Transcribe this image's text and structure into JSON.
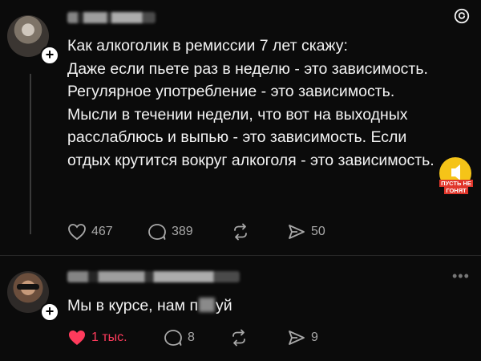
{
  "post": {
    "text": "Как алкоголик в ремиссии 7 лет скажу:\nДаже если пьете раз в неделю - это зависимость. Регулярное употребление - это зависимость. Мысли в течении недели, что вот на выходных расслаблюсь и выпью - это зависимость. Если отдых крутится вокруг алкоголя - это зависимость.",
    "likes": "467",
    "replies": "389",
    "shares": "50"
  },
  "reply": {
    "text_before": "Мы в курсе, нам п",
    "text_after": "уй",
    "likes": "1 тыс.",
    "replies": "8",
    "shares": "9"
  },
  "badge": {
    "line1": "Пусть не",
    "line2": "гонят"
  },
  "colors": {
    "background": "#0b0b0b",
    "text": "#f3f3f3",
    "muted": "#a8a8a8",
    "liked": "#ff3b5c",
    "badge_yellow": "#f5c418",
    "badge_red": "#e0362b"
  },
  "icons": [
    "threads-logo-icon",
    "heart-icon",
    "comment-icon",
    "repost-icon",
    "share-icon",
    "more-icon",
    "plus-icon"
  ]
}
